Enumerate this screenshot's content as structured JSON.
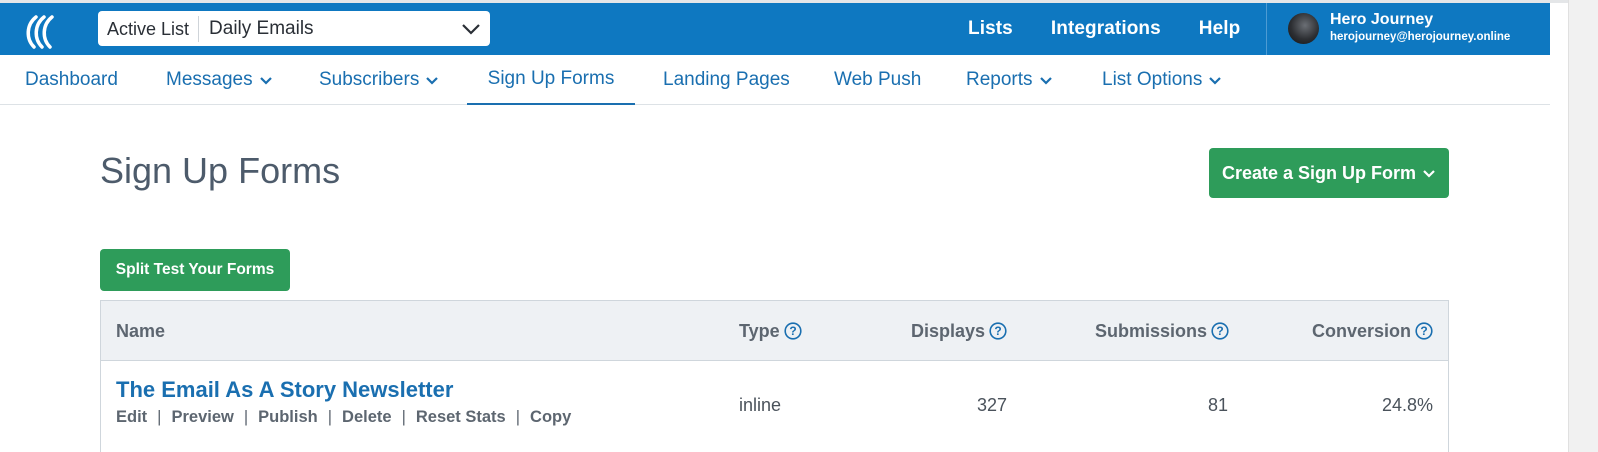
{
  "header": {
    "list_selector": {
      "label": "Active List",
      "value": "Daily Emails"
    },
    "links": [
      "Lists",
      "Integrations",
      "Help"
    ],
    "user": {
      "name": "Hero Journey",
      "email": "herojourney@herojourney.online"
    },
    "brand_color": "#0e78c1"
  },
  "nav": {
    "items": [
      {
        "label": "Dashboard"
      },
      {
        "label": "Messages"
      },
      {
        "label": "Subscribers"
      },
      {
        "label": "Sign Up Forms"
      },
      {
        "label": "Landing Pages"
      },
      {
        "label": "Web Push"
      },
      {
        "label": "Reports"
      },
      {
        "label": "List Options"
      }
    ],
    "active": "Sign Up Forms"
  },
  "page": {
    "title": "Sign Up Forms",
    "create_button": "Create a Sign Up Form",
    "split_button": "Split Test Your Forms",
    "accent_color": "#2e9c5a"
  },
  "table": {
    "columns": [
      "Name",
      "Type",
      "Displays",
      "Submissions",
      "Conversion"
    ],
    "rows": [
      {
        "name": "The Email As A Story Newsletter",
        "actions": [
          "Edit",
          "Preview",
          "Publish",
          "Delete",
          "Reset Stats",
          "Copy"
        ],
        "type": "inline",
        "displays": "327",
        "submissions": "81",
        "conversion": "24.8%"
      }
    ]
  }
}
